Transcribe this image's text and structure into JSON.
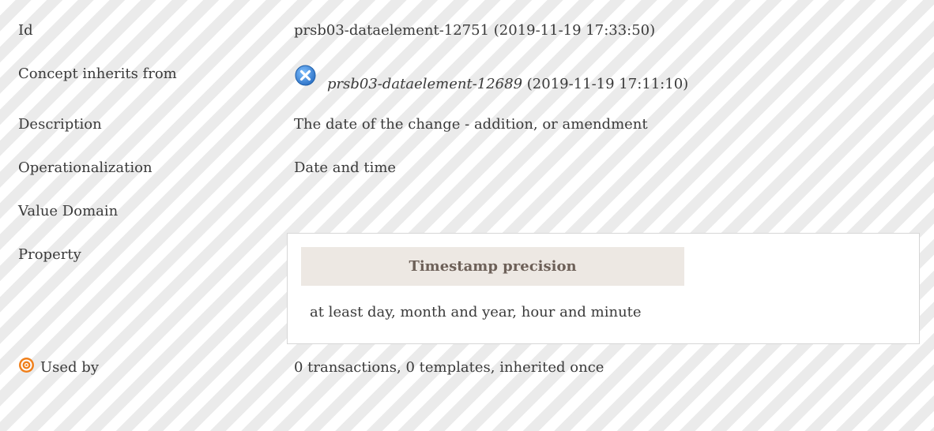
{
  "rows": {
    "id": {
      "label": "Id",
      "value": "prsb03-dataelement-12751 (2019-11-19 17:33:50)"
    },
    "inherits": {
      "label": "Concept inherits from",
      "link_text": "prsb03-dataelement-12689",
      "date": "(2019-11-19 17:11:10)",
      "icon": "blue-x-circle-icon"
    },
    "description": {
      "label": "Description",
      "value": "The date of the change - addition, or amendment"
    },
    "operationalization": {
      "label": "Operationalization",
      "value": "Date and time"
    },
    "value_domain": {
      "label": "Value Domain"
    },
    "property": {
      "label": "Property",
      "header": "Timestamp precision",
      "value": "at least day, month and year, hour and minute"
    },
    "used_by": {
      "label": "Used by",
      "value": "0 transactions, 0 templates, inherited once",
      "icon": "orange-target-icon"
    }
  },
  "colors": {
    "x_icon": "#3c8de0",
    "target_icon": "#f07f1a",
    "property_header_bg": "#ede8e3",
    "property_header_text": "#6d6058"
  }
}
